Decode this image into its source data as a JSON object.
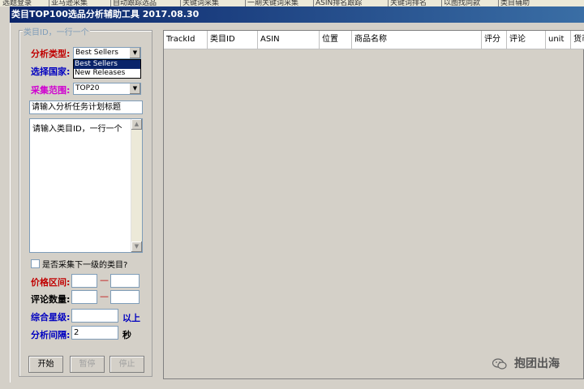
{
  "background_tabs": [
    "选题登录",
    "亚马逊采集",
    "自动跟踪选品",
    "关键词采集",
    "一期关键词采集",
    "ASIN排名跟踪",
    "关键词排名",
    "以图找同款",
    "类目辅助"
  ],
  "window": {
    "title": "类目TOP100选品分析辅助工具 2017.08.30"
  },
  "form": {
    "group_title": "类目ID，一行一个",
    "analysis_type_label": "分析类型:",
    "analysis_type_value": "Best Sellers",
    "analysis_type_options": [
      "Best Sellers",
      "New Releases"
    ],
    "country_label": "选择国家:",
    "range_label": "采集范围:",
    "range_value": "TOP20",
    "task_title_value": "请输入分析任务计划标题",
    "category_ids_value": "请输入类目ID，一行一个",
    "subcategory_checkbox_label": "是否采集下一级的类目?",
    "price_range_label": "价格区间:",
    "range_dash": "—",
    "review_count_label": "评论数量:",
    "rating_label": "综合星级:",
    "rating_suffix": "以上",
    "interval_label": "分析间隔:",
    "interval_value": "2",
    "interval_unit": "秒"
  },
  "buttons": {
    "start": "开始",
    "pause": "暂停",
    "stop": "停止"
  },
  "grid": {
    "columns": [
      "TrackId",
      "类目ID",
      "ASIN",
      "位置",
      "商品名称",
      "评分",
      "评论",
      "unit",
      "货币"
    ]
  },
  "watermark": {
    "text": "抱团出海"
  }
}
